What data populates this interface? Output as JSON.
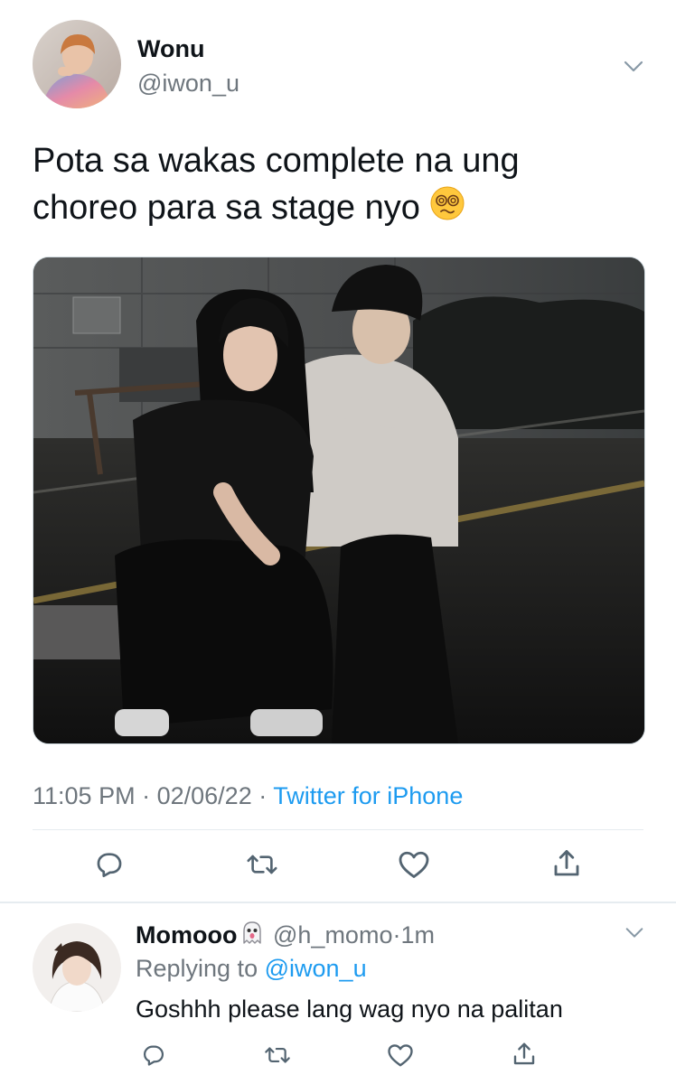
{
  "tweet": {
    "author_name": "Wonu",
    "author_handle": "@iwon_u",
    "text_line1": "Pota sa wakas complete na ung",
    "text_line2": "choreo para sa stage nyo",
    "emoji": "dizzy-face-emoji",
    "time": "11:05 PM",
    "sep1": "·",
    "date": "02/06/22",
    "sep2": "·",
    "source": "Twitter for iPhone",
    "media": "photo-two-people-crouching-street-night"
  },
  "reply": {
    "author_name": "Momooo",
    "author_emoji": "ghost-emoji",
    "author_handle": "@h_momo",
    "sep": "·",
    "time": "1m",
    "replying_prefix": "Replying to",
    "replying_to": "@iwon_u",
    "text": "Goshhh please lang wag nyo na palitan"
  },
  "icons": {
    "reply": "reply-icon",
    "retweet": "retweet-icon",
    "like": "heart-icon",
    "share": "share-icon",
    "more": "chevron-down-icon"
  },
  "colors": {
    "link": "#1d9bf0",
    "muted": "#6e767d",
    "text": "#0f1419",
    "divider": "#e6ecf0"
  }
}
